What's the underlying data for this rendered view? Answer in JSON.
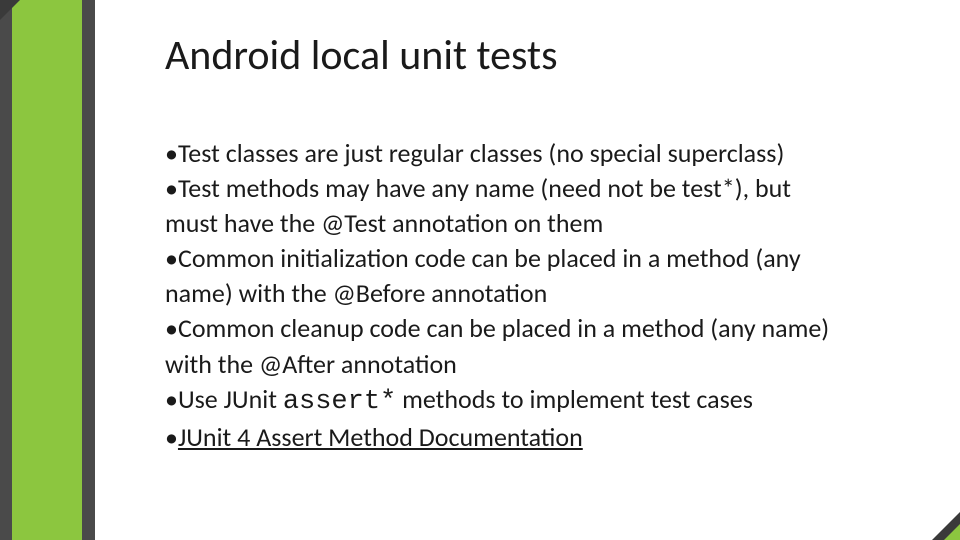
{
  "slide": {
    "title": "Android local unit tests",
    "bullets": {
      "b1_pre": "•Test classes are just regular classes (no special superclass)",
      "b2_pre": "•Test methods may have any name (need not be test*), but must have the @Test annotation on them",
      "b3_pre": "•Common initialization code can be placed in a method (any name) with the @Before annotation",
      "b4_pre": "•Common cleanup code can be placed in a method (any name) with the @After annotation",
      "b5_pre": "•Use JUnit ",
      "b5_code": "assert*",
      "b5_post": " methods to implement test cases",
      "b6_pre": "•",
      "b6_link": "JUnit 4 Assert Method Documentation"
    }
  }
}
